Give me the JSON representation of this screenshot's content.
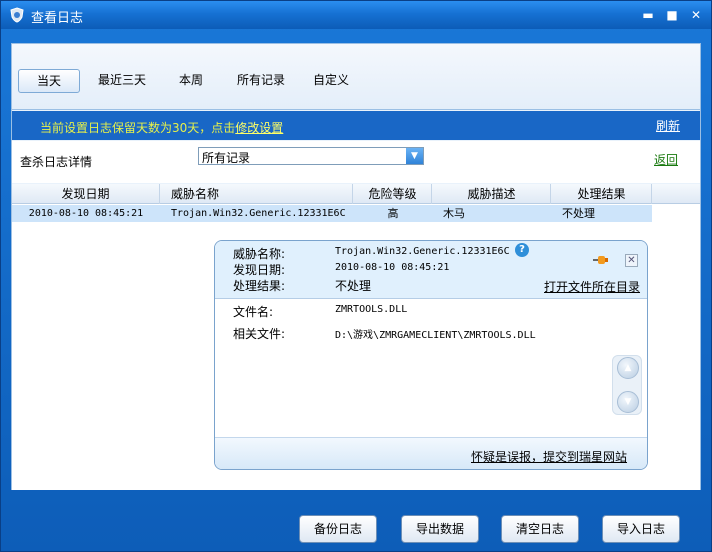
{
  "window": {
    "title": "查看日志",
    "minimize": "▬",
    "maximize": "■",
    "close": "✕"
  },
  "tabs": [
    {
      "label": "当天",
      "active": true
    },
    {
      "label": "最近三天"
    },
    {
      "label": "本周"
    },
    {
      "label": "所有记录"
    },
    {
      "label": "自定义"
    }
  ],
  "infobar": {
    "text": "当前设置日志保留天数为30天，点击",
    "link": "修改设置",
    "refresh": "刷新"
  },
  "detail": {
    "label": "查杀日志详情",
    "select_value": "所有记录",
    "back": "返回"
  },
  "table": {
    "columns": [
      "发现日期",
      "威胁名称",
      "危险等级",
      "威胁描述",
      "处理结果"
    ],
    "rows": [
      [
        "2010-08-10 08:45:21",
        "Trojan.Win32.Generic.12331E6C",
        "高",
        "木马",
        "不处理"
      ]
    ]
  },
  "popup": {
    "threat_name_label": "威胁名称:",
    "threat_name": "Trojan.Win32.Generic.12331E6C",
    "date_label": "发现日期:",
    "date": "2010-08-10 08:45:21",
    "result_label": "处理结果:",
    "result": "不处理",
    "open_folder": "打开文件所在目录",
    "file_label": "文件名:",
    "file": "ZMRTOOLS.DLL",
    "related_label": "相关文件:",
    "related": "D:\\游戏\\ZMRGAMECLIENT\\ZMRTOOLS.DLL",
    "report": "怀疑是误报，提交到瑞星网站",
    "help": "?"
  },
  "buttons": {
    "backup": "备份日志",
    "export": "导出数据",
    "clear": "清空日志",
    "import": "导入日志"
  },
  "colors": {
    "window_blue": "#1671d3",
    "infobar_blue": "#1967c6",
    "info_yellow": "#e6f04a",
    "row_select": "#cde4fa"
  }
}
